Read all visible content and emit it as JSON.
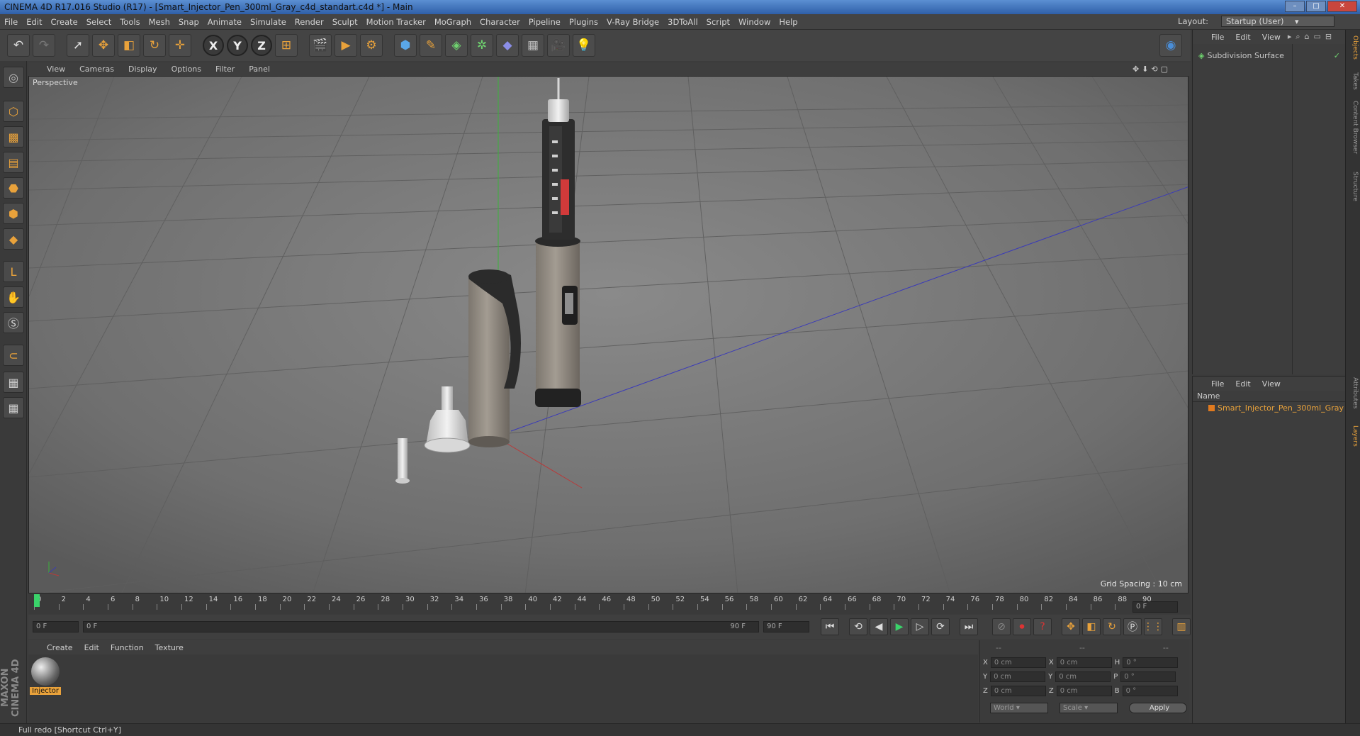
{
  "window": {
    "title": "CINEMA 4D R17.016 Studio (R17) - [Smart_Injector_Pen_300ml_Gray_c4d_standart.c4d *] - Main"
  },
  "menu": [
    "File",
    "Edit",
    "Create",
    "Select",
    "Tools",
    "Mesh",
    "Snap",
    "Animate",
    "Simulate",
    "Render",
    "Sculpt",
    "Motion Tracker",
    "MoGraph",
    "Character",
    "Pipeline",
    "Plugins",
    "V-Ray Bridge",
    "3DToAll",
    "Script",
    "Window",
    "Help"
  ],
  "layout": {
    "label": "Layout:",
    "value": "Startup (User)"
  },
  "viewport": {
    "menu": [
      "View",
      "Cameras",
      "Display",
      "Options",
      "Filter",
      "Panel"
    ],
    "label": "Perspective",
    "grid_spacing": "Grid Spacing : 10 cm"
  },
  "timeline": {
    "ticks": [
      "0",
      "2",
      "4",
      "6",
      "8",
      "10",
      "12",
      "14",
      "16",
      "18",
      "20",
      "22",
      "24",
      "26",
      "28",
      "30",
      "32",
      "34",
      "36",
      "38",
      "40",
      "42",
      "44",
      "46",
      "48",
      "50",
      "52",
      "54",
      "56",
      "58",
      "60",
      "62",
      "64",
      "66",
      "68",
      "70",
      "72",
      "74",
      "76",
      "78",
      "80",
      "82",
      "84",
      "86",
      "88",
      "90"
    ],
    "current_frame": "0 F",
    "start_frame": "0 F",
    "range_start": "0 F",
    "range_end": "90 F",
    "end_frame": "90 F"
  },
  "material_manager": {
    "menu": [
      "Create",
      "Edit",
      "Function",
      "Texture"
    ],
    "materials": [
      {
        "name": "Injector"
      }
    ]
  },
  "coordinates": {
    "headers": [
      "--",
      "--",
      "--"
    ],
    "rows": [
      {
        "a": "X",
        "av": "0 cm",
        "b": "X",
        "bv": "0 cm",
        "c": "H",
        "cv": "0 °"
      },
      {
        "a": "Y",
        "av": "0 cm",
        "b": "Y",
        "bv": "0 cm",
        "c": "P",
        "cv": "0 °"
      },
      {
        "a": "Z",
        "av": "0 cm",
        "b": "Z",
        "bv": "0 cm",
        "c": "B",
        "cv": "0 °"
      }
    ],
    "mode": "World",
    "scale": "Scale",
    "apply": "Apply"
  },
  "object_manager": {
    "menu": [
      "File",
      "Edit",
      "View"
    ],
    "objects": [
      {
        "name": "Subdivision Surface"
      }
    ]
  },
  "layer_manager": {
    "menu": [
      "File",
      "Edit",
      "View"
    ],
    "column": "Name",
    "items": [
      {
        "name": "Smart_Injector_Pen_300ml_Gray"
      }
    ]
  },
  "right_tabs": [
    "Objects",
    "Takes",
    "Content Browser",
    "Structure",
    "Attributes",
    "Layers"
  ],
  "status": "Full redo [Shortcut Ctrl+Y]",
  "brand": "MAXON CINEMA 4D",
  "colors": {
    "accent": "#e9a23b",
    "layer_color": "#e07a1f",
    "playhead": "#3ad36a"
  }
}
